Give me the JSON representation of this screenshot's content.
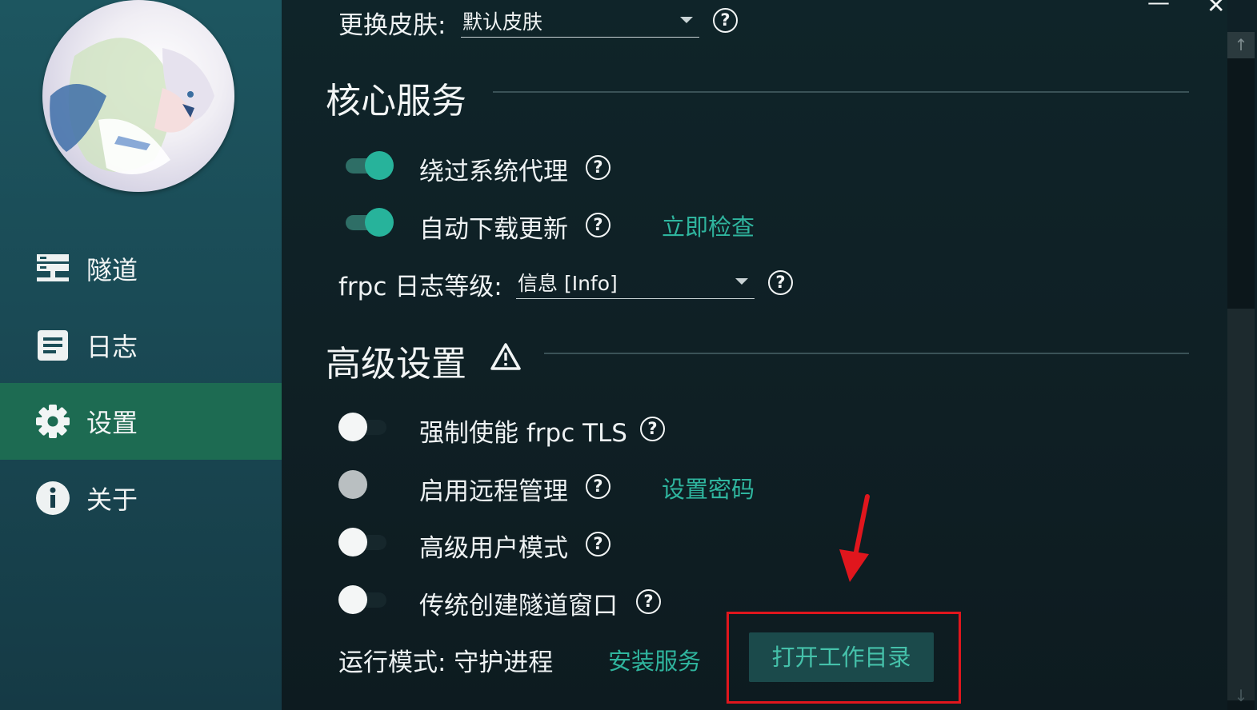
{
  "sidebar": {
    "items": [
      {
        "label": "隧道",
        "icon": "server-icon"
      },
      {
        "label": "日志",
        "icon": "document-icon"
      },
      {
        "label": "设置",
        "icon": "gear-icon",
        "active": true
      },
      {
        "label": "关于",
        "icon": "info-icon"
      }
    ]
  },
  "settings": {
    "skin": {
      "label": "更换皮肤:",
      "value": "默认皮肤"
    },
    "core": {
      "title": "核心服务",
      "bypass_proxy": {
        "label": "绕过系统代理",
        "enabled": true
      },
      "auto_update": {
        "label": "自动下载更新",
        "enabled": true,
        "action": "立即检查"
      },
      "log_level": {
        "label": "frpc 日志等级:",
        "value": "信息 [Info]"
      }
    },
    "advanced": {
      "title": "高级设置",
      "force_tls": {
        "label": "强制使能 frpc TLS",
        "enabled": false
      },
      "remote_mgmt": {
        "label": "启用远程管理",
        "enabled": false,
        "disabled": true,
        "action": "设置密码"
      },
      "advanced_user": {
        "label": "高级用户模式",
        "enabled": false
      },
      "classic_window": {
        "label": "传统创建隧道窗口",
        "enabled": false
      },
      "run_mode": {
        "label": "运行模式: 守护进程",
        "install_action": "安装服务"
      },
      "open_workdir": "打开工作目录"
    },
    "help_glyph": "?"
  },
  "window": {
    "minimize_glyph": "—",
    "close_glyph": "✕"
  },
  "colors": {
    "accent": "#27b39b",
    "active_nav": "#1d6b52",
    "highlight": "#e0161d"
  }
}
